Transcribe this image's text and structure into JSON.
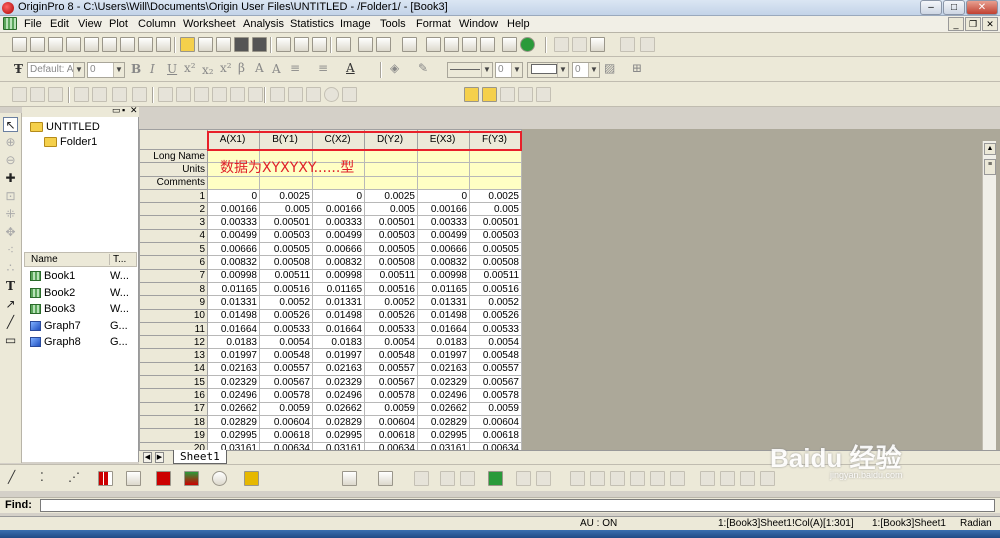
{
  "window": {
    "title": "OriginPro 8 - C:\\Users\\Will\\Documents\\Origin User Files\\UNTITLED - /Folder1/ - [Book3]"
  },
  "menu": [
    "File",
    "Edit",
    "View",
    "Plot",
    "Column",
    "Worksheet",
    "Analysis",
    "Statistics",
    "Image",
    "Tools",
    "Format",
    "Window",
    "Help"
  ],
  "format_toolbar": {
    "font": "Default: A",
    "size": "0",
    "line_width": "0",
    "border": "0",
    "bold": "B",
    "italic": "I",
    "underline": "U"
  },
  "explorer": {
    "root": "UNTITLED",
    "folder": "Folder1",
    "list_headers": [
      "Name",
      "T..."
    ],
    "items": [
      {
        "name": "Book1",
        "type": "W..."
      },
      {
        "name": "Book2",
        "type": "W..."
      },
      {
        "name": "Book3",
        "type": "W..."
      },
      {
        "name": "Graph7",
        "type": "G..."
      },
      {
        "name": "Graph8",
        "type": "G..."
      }
    ]
  },
  "worksheet": {
    "columns": [
      "A(X1)",
      "B(Y1)",
      "C(X2)",
      "D(Y2)",
      "E(X3)",
      "F(Y3)"
    ],
    "meta_rows": [
      "Long Name",
      "Units",
      "Comments"
    ],
    "annotation": "数据为XYXYXY......型",
    "rows": [
      [
        "1",
        "0",
        "0.0025",
        "0",
        "0.0025",
        "0",
        "0.0025"
      ],
      [
        "2",
        "0.00166",
        "0.005",
        "0.00166",
        "0.005",
        "0.00166",
        "0.005"
      ],
      [
        "3",
        "0.00333",
        "0.00501",
        "0.00333",
        "0.00501",
        "0.00333",
        "0.00501"
      ],
      [
        "4",
        "0.00499",
        "0.00503",
        "0.00499",
        "0.00503",
        "0.00499",
        "0.00503"
      ],
      [
        "5",
        "0.00666",
        "0.00505",
        "0.00666",
        "0.00505",
        "0.00666",
        "0.00505"
      ],
      [
        "6",
        "0.00832",
        "0.00508",
        "0.00832",
        "0.00508",
        "0.00832",
        "0.00508"
      ],
      [
        "7",
        "0.00998",
        "0.00511",
        "0.00998",
        "0.00511",
        "0.00998",
        "0.00511"
      ],
      [
        "8",
        "0.01165",
        "0.00516",
        "0.01165",
        "0.00516",
        "0.01165",
        "0.00516"
      ],
      [
        "9",
        "0.01331",
        "0.0052",
        "0.01331",
        "0.0052",
        "0.01331",
        "0.0052"
      ],
      [
        "10",
        "0.01498",
        "0.00526",
        "0.01498",
        "0.00526",
        "0.01498",
        "0.00526"
      ],
      [
        "11",
        "0.01664",
        "0.00533",
        "0.01664",
        "0.00533",
        "0.01664",
        "0.00533"
      ],
      [
        "12",
        "0.0183",
        "0.0054",
        "0.0183",
        "0.0054",
        "0.0183",
        "0.0054"
      ],
      [
        "13",
        "0.01997",
        "0.00548",
        "0.01997",
        "0.00548",
        "0.01997",
        "0.00548"
      ],
      [
        "14",
        "0.02163",
        "0.00557",
        "0.02163",
        "0.00557",
        "0.02163",
        "0.00557"
      ],
      [
        "15",
        "0.02329",
        "0.00567",
        "0.02329",
        "0.00567",
        "0.02329",
        "0.00567"
      ],
      [
        "16",
        "0.02496",
        "0.00578",
        "0.02496",
        "0.00578",
        "0.02496",
        "0.00578"
      ],
      [
        "17",
        "0.02662",
        "0.0059",
        "0.02662",
        "0.0059",
        "0.02662",
        "0.0059"
      ],
      [
        "18",
        "0.02829",
        "0.00604",
        "0.02829",
        "0.00604",
        "0.02829",
        "0.00604"
      ],
      [
        "19",
        "0.02995",
        "0.00618",
        "0.02995",
        "0.00618",
        "0.02995",
        "0.00618"
      ],
      [
        "20",
        "0.03161",
        "0.00634",
        "0.03161",
        "0.00634",
        "0.03161",
        "0.00634"
      ]
    ],
    "sheet_tab": "Sheet1"
  },
  "find": {
    "label": "Find:"
  },
  "status": {
    "au": "AU : ON",
    "cell": "1:[Book3]Sheet1!Col(A)[1:301]",
    "sheet": "1:[Book3]Sheet1",
    "angle": "Radian"
  },
  "watermark": {
    "text": "Baidu 经验",
    "sub": "jingyan.baidu.com"
  },
  "colors": {
    "highlight": "#e8202a",
    "meta_bg": "#ffffc4",
    "annotation": "#e0202a"
  }
}
